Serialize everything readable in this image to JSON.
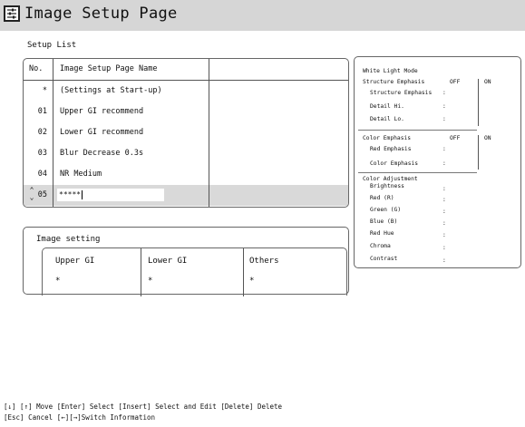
{
  "header": {
    "title": "Image Setup Page",
    "icon": "settings-list-icon"
  },
  "setup_list": {
    "caption": "Setup List",
    "headers": {
      "no": "No.",
      "name": "Image Setup Page Name",
      "extra": ""
    },
    "rows": [
      {
        "no": "*",
        "name": "(Settings at Start-up)"
      },
      {
        "no": "01",
        "name": "Upper GI recommend"
      },
      {
        "no": "02",
        "name": "Lower GI recommend"
      },
      {
        "no": "03",
        "name": "Blur Decrease 0.3s"
      },
      {
        "no": "04",
        "name": "NR Medium"
      }
    ],
    "selected": {
      "no": "05",
      "value": "*****",
      "arrows": "⌃⌄"
    }
  },
  "image_setting": {
    "title": "Image setting",
    "columns": [
      {
        "header": "Upper GI",
        "value": "*"
      },
      {
        "header": "Lower GI",
        "value": "*"
      },
      {
        "header": "Others",
        "value": "*"
      }
    ]
  },
  "info_panel": {
    "mode": "White Light Mode",
    "structure": {
      "label": "Structure Emphasis",
      "off": "OFF",
      "on": "ON",
      "items": [
        "Structure Emphasis",
        "Detail Hi.",
        "Detail Lo."
      ]
    },
    "color_emphasis": {
      "label": "Color Emphasis",
      "off": "OFF",
      "on": "ON",
      "items": [
        "Red Emphasis",
        "Color Emphasis"
      ]
    },
    "color_adjustment": {
      "label": "Color Adjustment",
      "items": [
        "Brightness",
        "Red (R)",
        "Green (G)",
        "Blue (B)",
        "Red Hue",
        "Chroma",
        "Contrast"
      ]
    },
    "colon": ":"
  },
  "help": {
    "line1": "[↓] [↑] Move  [Enter] Select  [Insert] Select and Edit  [Delete] Delete",
    "line2": "[Esc] Cancel  [←][→]Switch Information"
  },
  "colors": {
    "titlebar": "#d6d6d6",
    "selected_row": "#d9d9d9",
    "border": "#555555"
  }
}
